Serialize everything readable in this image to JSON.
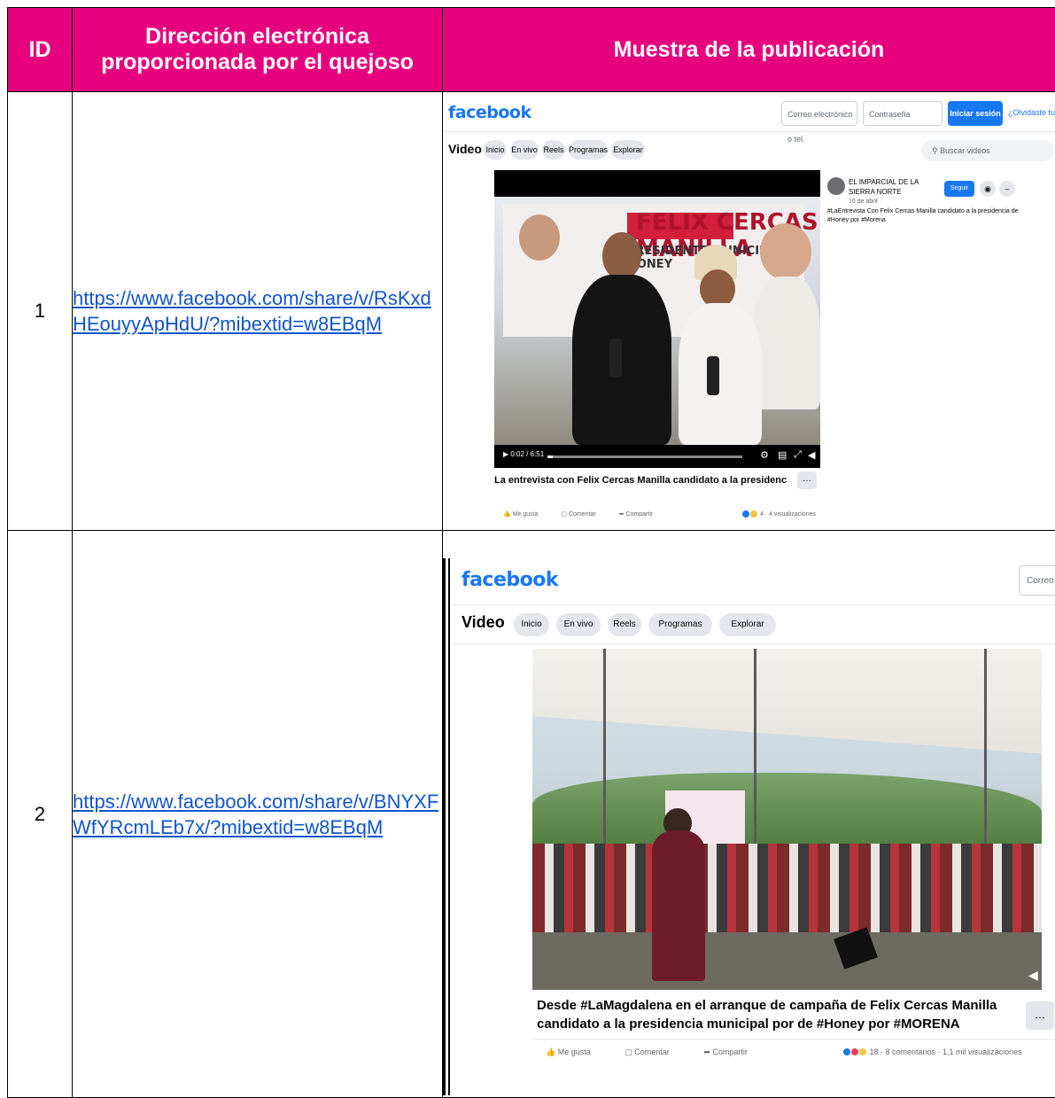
{
  "table": {
    "headers": {
      "id": "ID",
      "url": "Dirección electrónica proporcionada por el quejoso",
      "sample": "Muestra de la publicación"
    },
    "rows": [
      {
        "id": "1",
        "url": "https://www.facebook.com/share/v/RsKxdHEouyyApHdU/?mibextid=w8EBqM"
      },
      {
        "id": "2",
        "url": "https://www.facebook.com/share/v/BNYXFWfYRcmLEb7x/?mibextid=w8EBqM"
      }
    ]
  },
  "screenshot1": {
    "logo": "facebook",
    "email_placeholder": "Correo electrónico o tel.",
    "password_placeholder": "Contraseña",
    "login_label": "Iniciar sesión",
    "forgot_label": "¿Olvidaste tu cuenta?",
    "section_title": "Video",
    "nav": [
      "Inicio",
      "En vivo",
      "Reels",
      "Programas",
      "Explorar"
    ],
    "search_placeholder": "Buscar videos",
    "banner_text": "FELIX CERCAS MANILLA",
    "banner_sub": "PRESIDENTE MUNICIPAL HONEY",
    "time": "0:02 / 6:51",
    "page_name": "EL IMPARCIAL DE LA SIERRA NORTE",
    "follow_label": "Seguir",
    "date": "16 de abril",
    "description": "#LaEntrevista Con Felix Cercas Manilla candidato a la presidencia de #Honey por #Morena",
    "caption": "La entrevista con Felix Cercas Manilla candidato a la presidencia de Hon...",
    "actions": [
      "Me gusta",
      "Comentar",
      "Compartir"
    ],
    "stats": "4 · 4 visualizaciones",
    "brand_color": "#1877f2"
  },
  "screenshot2": {
    "logo": "facebook",
    "email_placeholder": "Correo",
    "section_title": "Video",
    "nav": [
      "Inicio",
      "En vivo",
      "Reels",
      "Programas",
      "Explorar"
    ],
    "caption": "Desde #LaMagdalena en el arranque de campaña de Felix Cercas Manilla candidato a la presidencia municipal por de #Honey por #MORENA",
    "actions": [
      "Me gusta",
      "Comentar",
      "Compartir"
    ],
    "stats": "18 · 8 comentarios · 1,1 mil visualizaciones"
  },
  "colors": {
    "header_bg": "#e6007e",
    "link": "#1155cc"
  }
}
